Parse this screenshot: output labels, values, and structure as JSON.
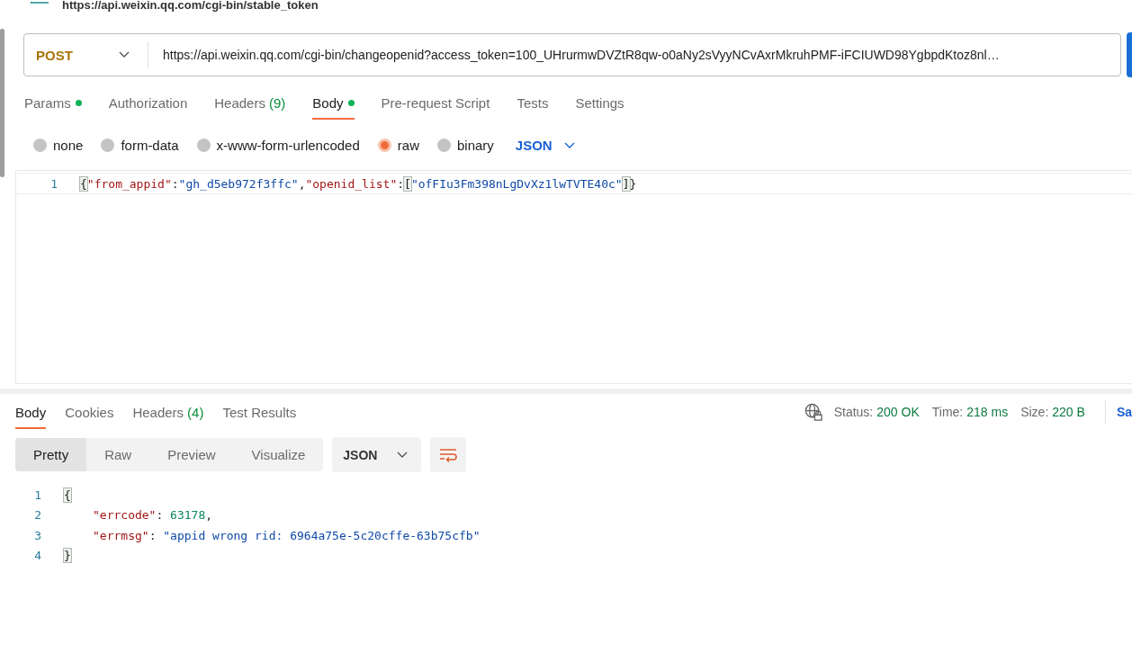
{
  "breadcrumb": "https://api.weixin.qq.com/cgi-bin/stable_token",
  "request": {
    "method": "POST",
    "url": "https://api.weixin.qq.com/cgi-bin/changeopenid?access_token=100_UHrurmwDVZtR8qw-o0aNy2sVyyNCvAxrMkruhPMF-iFCIUWD98YgbpdKtoz8nl…"
  },
  "request_tabs": [
    {
      "label": "Params",
      "dot": true,
      "selected": false
    },
    {
      "label": "Authorization",
      "dot": false,
      "selected": false
    },
    {
      "label": "Headers",
      "count": "(9)",
      "dot": false,
      "selected": false
    },
    {
      "label": "Body",
      "dot": true,
      "selected": true
    },
    {
      "label": "Pre-request Script",
      "dot": false,
      "selected": false
    },
    {
      "label": "Tests",
      "dot": false,
      "selected": false
    },
    {
      "label": "Settings",
      "dot": false,
      "selected": false
    }
  ],
  "body_types": [
    {
      "label": "none",
      "selected": false
    },
    {
      "label": "form-data",
      "selected": false
    },
    {
      "label": "x-www-form-urlencoded",
      "selected": false
    },
    {
      "label": "raw",
      "selected": true
    },
    {
      "label": "binary",
      "selected": false
    }
  ],
  "body_format": "JSON",
  "request_body": [
    {
      "number": "1",
      "tokens": [
        {
          "kind": "punct",
          "text": "{",
          "matched": true
        },
        {
          "kind": "key",
          "text": "\"from_appid\""
        },
        {
          "kind": "punct",
          "text": ":"
        },
        {
          "kind": "string",
          "text": "\"gh_d5eb972f3ffc\""
        },
        {
          "kind": "punct",
          "text": ","
        },
        {
          "kind": "key",
          "text": "\"openid_list\""
        },
        {
          "kind": "punct",
          "text": ":"
        },
        {
          "kind": "punct",
          "text": "[",
          "matched": true
        },
        {
          "kind": "string",
          "text": "\"ofFIu3Fm398nLgDvXz1lwTVTE40c\""
        },
        {
          "kind": "punct",
          "text": "]",
          "matched": true
        },
        {
          "kind": "punct",
          "text": "}"
        }
      ]
    }
  ],
  "response_tabs": [
    {
      "label": "Body",
      "selected": true
    },
    {
      "label": "Cookies",
      "selected": false
    },
    {
      "label": "Headers",
      "count": "(4)",
      "selected": false
    },
    {
      "label": "Test Results",
      "selected": false
    }
  ],
  "response_status": [
    {
      "label": "Status:",
      "value": "200 OK"
    },
    {
      "label": "Time:",
      "value": "218 ms"
    },
    {
      "label": "Size:",
      "value": "220 B"
    }
  ],
  "save_link": "Sa",
  "view_modes": [
    {
      "label": "Pretty",
      "selected": true
    },
    {
      "label": "Raw",
      "selected": false
    },
    {
      "label": "Preview",
      "selected": false
    },
    {
      "label": "Visualize",
      "selected": false
    }
  ],
  "response_format": "JSON",
  "response_body": [
    {
      "number": "1",
      "tokens": [
        {
          "kind": "punct",
          "text": "{",
          "matched": true
        }
      ],
      "children": [
        {
          "number": "2",
          "tokens": [
            {
              "kind": "key",
              "text": "\"errcode\""
            },
            {
              "kind": "punct",
              "text": ": "
            },
            {
              "kind": "number",
              "text": "63178"
            },
            {
              "kind": "punct",
              "text": ","
            }
          ]
        },
        {
          "number": "3",
          "tokens": [
            {
              "kind": "key",
              "text": "\"errmsg\""
            },
            {
              "kind": "punct",
              "text": ": "
            },
            {
              "kind": "string",
              "text": "\"appid wrong rid: 6964a75e-5c20cffe-63b75cfb\""
            }
          ]
        }
      ]
    },
    {
      "number": "4",
      "tokens": [
        {
          "kind": "punct",
          "text": "}",
          "matched": true
        }
      ]
    }
  ]
}
